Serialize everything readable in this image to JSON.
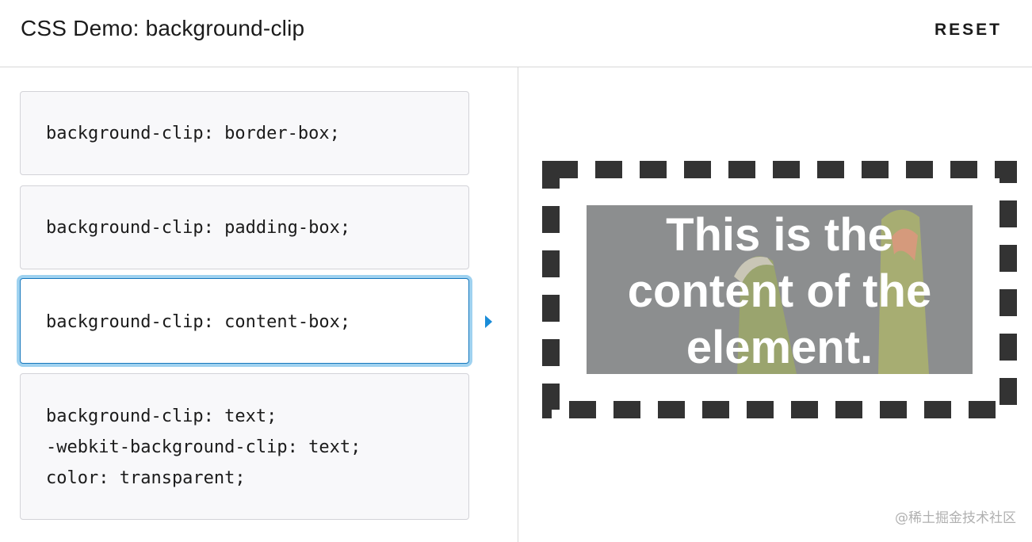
{
  "header": {
    "title": "CSS Demo: background-clip",
    "reset_label": "RESET"
  },
  "choices": [
    {
      "lines": [
        "background-clip: border-box;"
      ]
    },
    {
      "lines": [
        "background-clip: padding-box;"
      ]
    },
    {
      "lines": [
        "background-clip: content-box;"
      ],
      "selected": true
    },
    {
      "lines": [
        "background-clip: text;",
        "-webkit-background-clip: text;",
        "color: transparent;"
      ]
    }
  ],
  "output": {
    "text": "This is the content of the element."
  },
  "watermark": "@稀土掘金技术社区",
  "colors": {
    "selected_border": "#1677bd",
    "selected_glow": "#9fd2f0",
    "arrow": "#1a8cd8",
    "dash_border": "#333333",
    "code_bg": "#f8f8fa"
  }
}
